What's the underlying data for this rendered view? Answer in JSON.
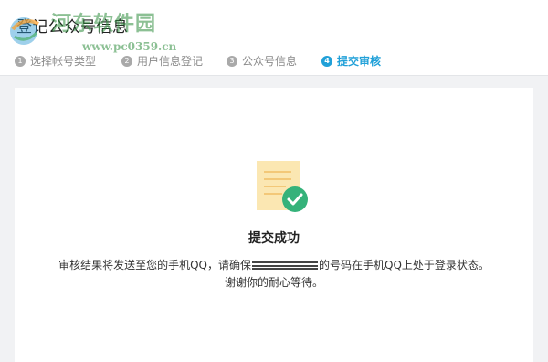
{
  "header": {
    "title": "登记公众号信息",
    "steps": [
      {
        "number": "1",
        "label": "选择帐号类型",
        "active": false
      },
      {
        "number": "2",
        "label": "用户信息登记",
        "active": false
      },
      {
        "number": "3",
        "label": "公众号信息",
        "active": false
      },
      {
        "number": "4",
        "label": "提交审核",
        "active": true
      }
    ]
  },
  "watermark": {
    "text": "河东软件园",
    "url": "www.pc0359.cn"
  },
  "result": {
    "title": "提交成功",
    "message_part1": "审核结果将发送至您的手机QQ，请确保",
    "message_part2": "的号码在手机QQ上处于登录状态。",
    "message_line2": "谢谢你的耐心等待。"
  },
  "colors": {
    "accent": "#20a0d8",
    "success_green": "#35b27a",
    "doc_yellow": "#fbe7b2",
    "background": "#f1f2f4"
  },
  "icons": {
    "success": "document-check-icon"
  }
}
